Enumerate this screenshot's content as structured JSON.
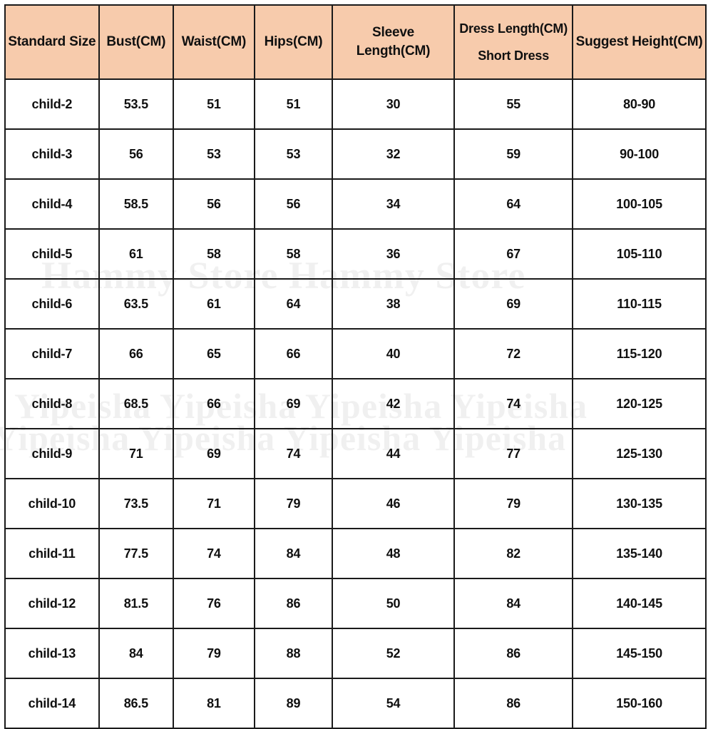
{
  "theme": {
    "header_bg": "#f7cbac",
    "border_color": "#1a1a1a",
    "text_color": "#101010",
    "page_bg": "#ffffff"
  },
  "watermarks": {
    "line_1": "Hammy Store Hammy Store",
    "line_2": "Yipeisha Yipeisha Yipeisha Yipeisha",
    "line_3": "Yipeisha Yipeisha Yipeisha Yipeisha"
  },
  "chart_data": {
    "type": "table",
    "title": "",
    "columns": [
      "Standard Size",
      "Bust(CM)",
      "Waist(CM)",
      "Hips(CM)",
      "Sleeve Length(CM)",
      "Dress Length(CM) Short Dress",
      "Suggest Height(CM)"
    ],
    "column_labels": [
      {
        "line1": "Standard Size",
        "line2": ""
      },
      {
        "line1": "Bust(CM)",
        "line2": ""
      },
      {
        "line1": "Waist(CM)",
        "line2": ""
      },
      {
        "line1": "Hips(CM)",
        "line2": ""
      },
      {
        "line1": "Sleeve Length(CM)",
        "line2": ""
      },
      {
        "line1": "Dress Length(CM)",
        "line2": "Short Dress"
      },
      {
        "line1": "Suggest Height(CM)",
        "line2": ""
      }
    ],
    "rows": [
      {
        "size": "child-2",
        "bust": "53.5",
        "waist": "51",
        "hips": "51",
        "sleeve": "30",
        "dress_length": "55",
        "suggest_height": "80-90"
      },
      {
        "size": "child-3",
        "bust": "56",
        "waist": "53",
        "hips": "53",
        "sleeve": "32",
        "dress_length": "59",
        "suggest_height": "90-100"
      },
      {
        "size": "child-4",
        "bust": "58.5",
        "waist": "56",
        "hips": "56",
        "sleeve": "34",
        "dress_length": "64",
        "suggest_height": "100-105"
      },
      {
        "size": "child-5",
        "bust": "61",
        "waist": "58",
        "hips": "58",
        "sleeve": "36",
        "dress_length": "67",
        "suggest_height": "105-110"
      },
      {
        "size": "child-6",
        "bust": "63.5",
        "waist": "61",
        "hips": "64",
        "sleeve": "38",
        "dress_length": "69",
        "suggest_height": "110-115"
      },
      {
        "size": "child-7",
        "bust": "66",
        "waist": "65",
        "hips": "66",
        "sleeve": "40",
        "dress_length": "72",
        "suggest_height": "115-120"
      },
      {
        "size": "child-8",
        "bust": "68.5",
        "waist": "66",
        "hips": "69",
        "sleeve": "42",
        "dress_length": "74",
        "suggest_height": "120-125"
      },
      {
        "size": "child-9",
        "bust": "71",
        "waist": "69",
        "hips": "74",
        "sleeve": "44",
        "dress_length": "77",
        "suggest_height": "125-130"
      },
      {
        "size": "child-10",
        "bust": "73.5",
        "waist": "71",
        "hips": "79",
        "sleeve": "46",
        "dress_length": "79",
        "suggest_height": "130-135"
      },
      {
        "size": "child-11",
        "bust": "77.5",
        "waist": "74",
        "hips": "84",
        "sleeve": "48",
        "dress_length": "82",
        "suggest_height": "135-140"
      },
      {
        "size": "child-12",
        "bust": "81.5",
        "waist": "76",
        "hips": "86",
        "sleeve": "50",
        "dress_length": "84",
        "suggest_height": "140-145"
      },
      {
        "size": "child-13",
        "bust": "84",
        "waist": "79",
        "hips": "88",
        "sleeve": "52",
        "dress_length": "86",
        "suggest_height": "145-150"
      },
      {
        "size": "child-14",
        "bust": "86.5",
        "waist": "81",
        "hips": "89",
        "sleeve": "54",
        "dress_length": "86",
        "suggest_height": "150-160"
      }
    ]
  }
}
